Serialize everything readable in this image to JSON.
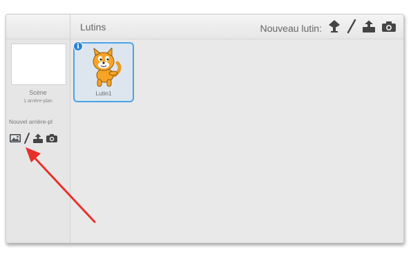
{
  "stage_panel": {
    "name": "Scène",
    "backdrop_count": "1 arrière-plan",
    "new_backdrop_label": "Nouvel arrière-pl",
    "tools": [
      "backdrop-library-icon",
      "paint-brush-icon",
      "upload-icon",
      "camera-icon"
    ]
  },
  "sprites_panel": {
    "title": "Lutins",
    "new_sprite_label": "Nouveau lutin:",
    "tools": [
      "sprite-library-icon",
      "paint-brush-icon",
      "upload-icon",
      "camera-icon"
    ]
  },
  "sprites": [
    {
      "name": "Lutin1",
      "selected": true
    }
  ],
  "annotation": {
    "type": "red-arrow",
    "color": "#e8302a",
    "points_to": "backdrop-library-icon"
  },
  "colors": {
    "selection_border": "#4aa2e8",
    "info_badge": "#2b83d6",
    "cat_orange": "#f7a427"
  }
}
